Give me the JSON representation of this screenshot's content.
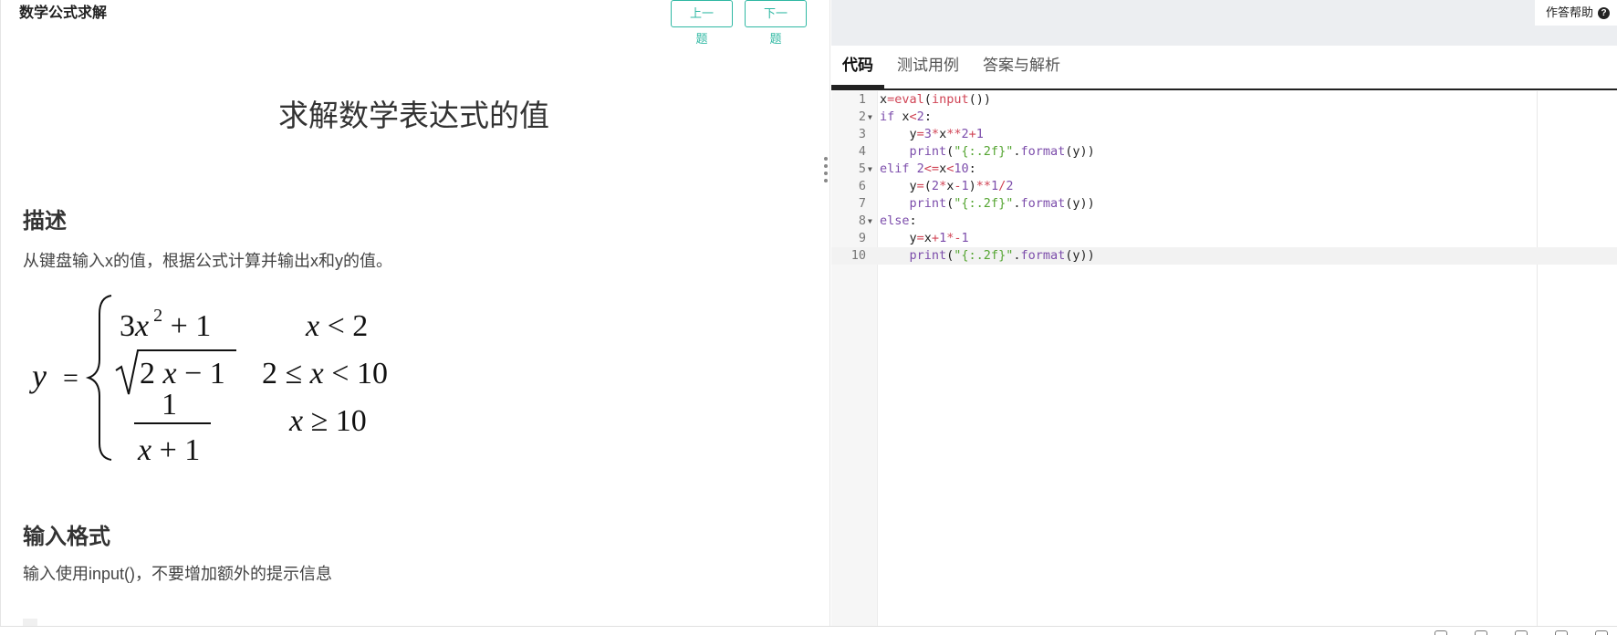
{
  "problem_pane": {
    "header": "数学公式求解",
    "prev_button": "上一题",
    "next_button": "下一题",
    "title": "求解数学表达式的值",
    "description_heading": "描述",
    "description_text": "从键盘输入x的值，根据公式计算并输出x和y的值。",
    "formula": {
      "lhs": "y",
      "eq": "=",
      "case1_expr": "3x² + 1",
      "case1_cond": "x < 2",
      "case2_expr": "√(2x − 1)",
      "case2_cond": "2 ≤ x < 10",
      "case3_num": "1",
      "case3_den": "x + 1",
      "case3_cond": "x ≥ 10"
    },
    "input_heading": "输入格式",
    "input_text": "输入使用input()，不要增加额外的提示信息"
  },
  "code_pane": {
    "help_label": "作答帮助",
    "tabs": [
      "代码",
      "测试用例",
      "答案与解析"
    ],
    "active_tab": 0,
    "active_line": 10,
    "lines": [
      "x=eval(input())",
      "if x<2:",
      "    y=3*x**2+1",
      "    print(\"{:.2f}\".format(y))",
      "elif 2<=x<10:",
      "    y=(2*x-1)**1/2",
      "    print(\"{:.2f}\".format(y))",
      "else:",
      "    y=x+1*-1",
      "    print(\"{:.2f}\".format(y))"
    ],
    "fold_lines": [
      2,
      5,
      8
    ]
  }
}
